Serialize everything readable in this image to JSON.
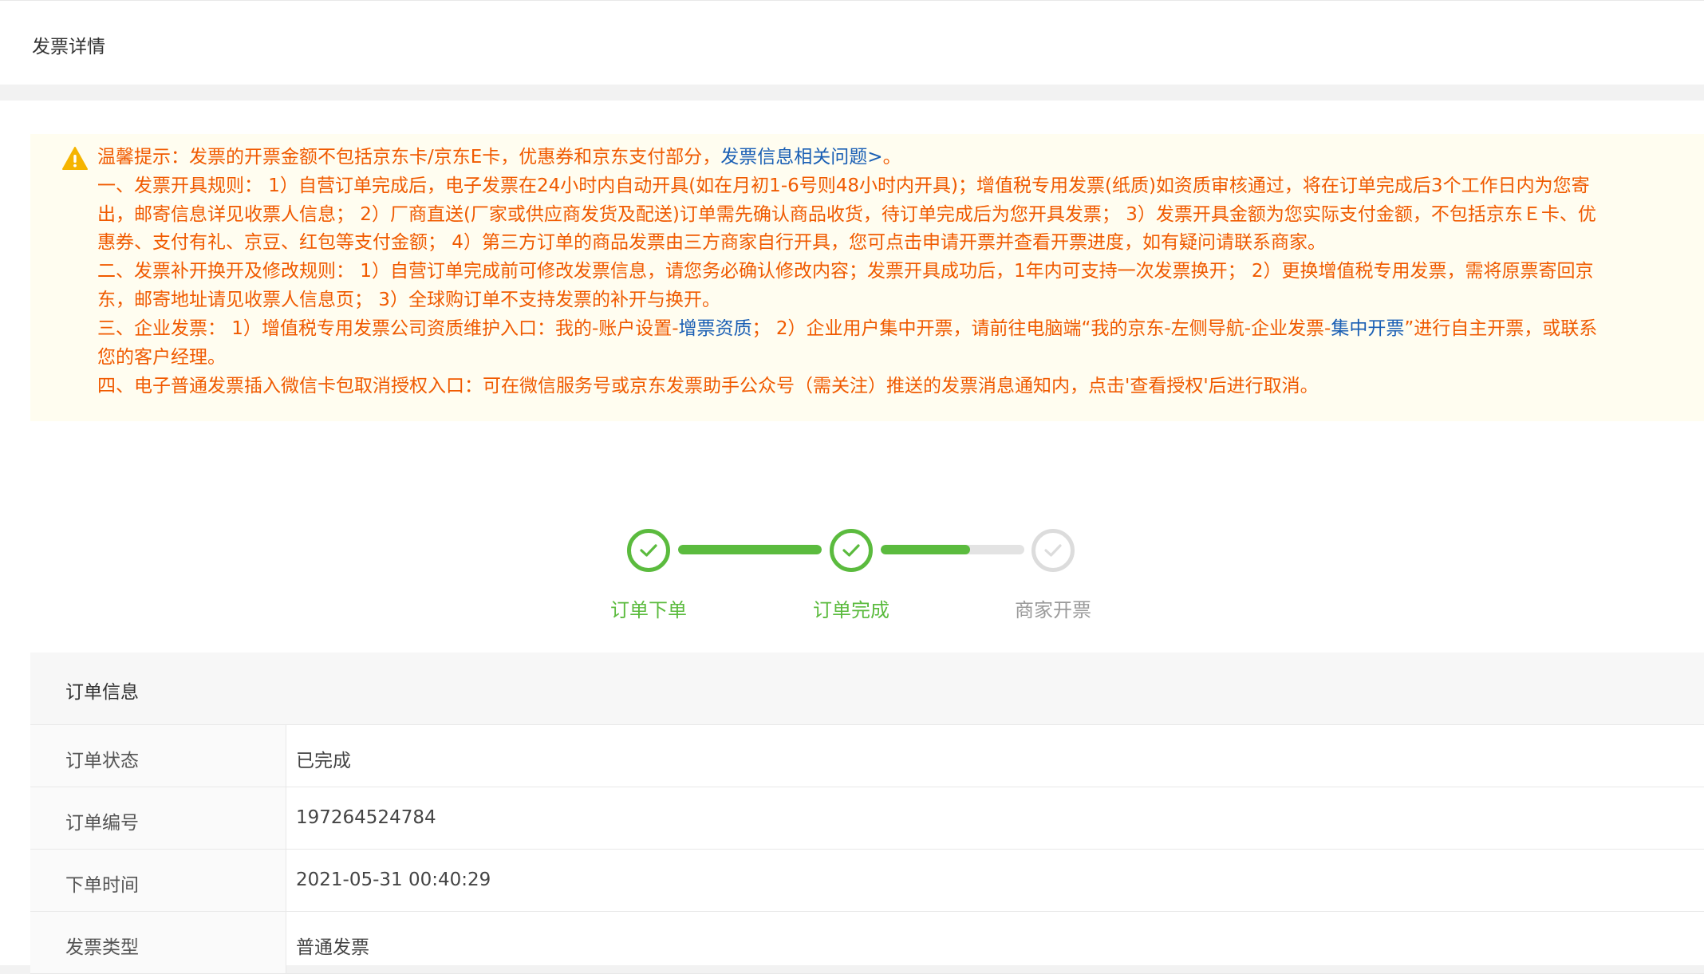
{
  "header": {
    "title": "发票详情"
  },
  "notice": {
    "icon": "warning-icon",
    "text_color": "#f05a00",
    "link_color": "#1a5fb4",
    "line1": {
      "prefix": "温馨提示：发票的开票金额不包括京东卡/京东E卡，优惠券和京东支付部分，",
      "link": "发票信息相关问题>",
      "suffix": "。"
    },
    "rule1": [
      "一、发票开具规则： 1）自营订单完成后，电子发票在24小时内自动开具(如在月初1-6号则48小时内开具)；增值税专用发票(纸质)如资质审核通过，将在订单完成后3个工作日内为您寄",
      "出，邮寄信息详见收票人信息； 2）厂商直送(厂家或供应商发货及配送)订单需先确认商品收货，待订单完成后为您开具发票； 3）发票开具金额为您实际支付金额，不包括京东Ｅ卡、优",
      "惠券、支付有礼、京豆、红包等支付金额； 4）第三方订单的商品发票由三方商家自行开具，您可点击申请开票并查看开票进度，如有疑问请联系商家。"
    ],
    "rule2": [
      "二、发票补开换开及修改规则： 1）自营订单完成前可修改发票信息，请您务必确认修改内容；发票开具成功后，1年内可支持一次发票换开； 2）更换增值税专用发票，需将原票寄回京",
      "东，邮寄地址请见收票人信息页； 3）全球购订单不支持发票的补开与换开。"
    ],
    "rule3": {
      "part1": "三、企业发票： 1）增值税专用发票公司资质维护入口：我的-账户设置-",
      "link1": "增票资质",
      "part2": "； 2）企业用户集中开票，请前往电脑端“我的京东-左侧导航-企业发票-",
      "link2": "集中开票",
      "part3": "”进行自主开票，或联系",
      "line2": "您的客户经理。"
    },
    "rule4": "四、电子普通发票插入微信卡包取消授权入口：可在微信服务号或京东发票助手公众号（需关注）推送的发票消息通知内，点击'查看授权'后进行取消。"
  },
  "progress": {
    "accent_color": "#5bbb3e",
    "steps": [
      {
        "label": "订单下单",
        "done": true
      },
      {
        "label": "订单完成",
        "done": true
      },
      {
        "label": "商家开票",
        "done": false
      }
    ],
    "connector_fill": [
      1,
      0.62
    ]
  },
  "order_info": {
    "title": "订单信息",
    "rows": [
      {
        "label": "订单状态",
        "value": "已完成"
      },
      {
        "label": "订单编号",
        "value": "197264524784"
      },
      {
        "label": "下单时间",
        "value": "2021-05-31 00:40:29"
      },
      {
        "label": "发票类型",
        "value": "普通发票"
      }
    ]
  }
}
